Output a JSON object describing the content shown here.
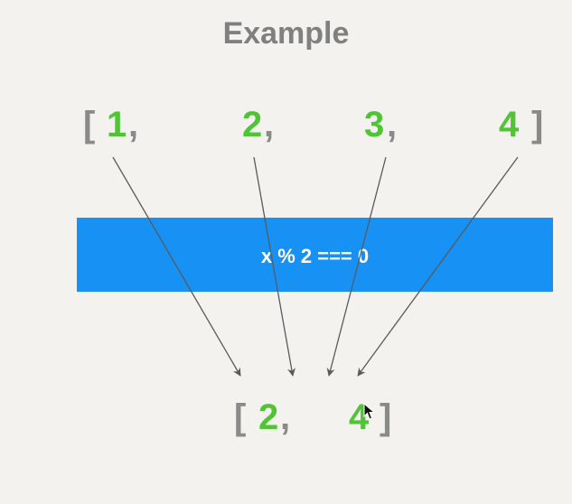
{
  "title": "Example",
  "input": {
    "open_bracket": "[",
    "close_bracket": "]",
    "items": [
      "1",
      "2",
      "3",
      "4"
    ],
    "comma": ","
  },
  "filter": {
    "expression": "x % 2 === 0",
    "color": "#1891f5"
  },
  "output": {
    "open_bracket": "[",
    "close_bracket": "]",
    "items": [
      "2",
      "4"
    ],
    "comma": ","
  },
  "colors": {
    "number": "#4fc435",
    "bracket": "#8a8a8a",
    "title": "#808080"
  }
}
